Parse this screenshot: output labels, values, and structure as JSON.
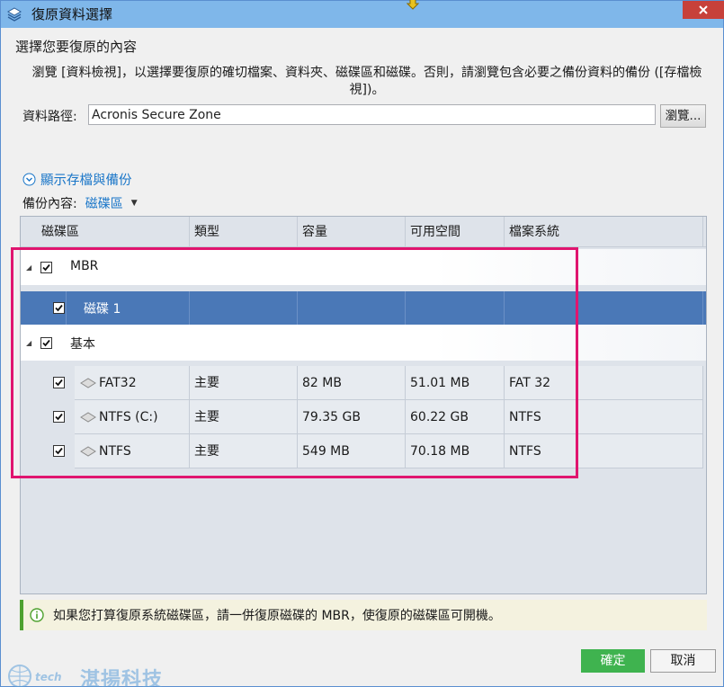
{
  "window": {
    "title": "復原資料選擇",
    "close_label": "✕"
  },
  "heading": "選擇您要復原的內容",
  "description": "瀏覽 [資料檢視]，以選擇要復原的確切檔案、資料夾、磁碟區和磁碟。否則，請瀏覽包含必要之備份資料的備份 ([存檔檢視])。",
  "path": {
    "label": "資料路徑:",
    "value": "Acronis Secure Zone",
    "browse_label": "瀏覽..."
  },
  "show_archives_label": "顯示存檔與備份",
  "backup_content": {
    "label": "備份內容:",
    "value": "磁碟區"
  },
  "grid": {
    "columns": [
      "磁碟區",
      "類型",
      "容量",
      "可用空間",
      "檔案系統"
    ],
    "groups": [
      {
        "label": "MBR",
        "items": [
          {
            "name": "磁碟 1",
            "type": "",
            "capacity": "",
            "free": "",
            "fs": "",
            "checked": true,
            "selected": true
          }
        ]
      },
      {
        "label": "基本",
        "items": [
          {
            "name": "FAT32",
            "type": "主要",
            "capacity": "82 MB",
            "free": "51.01 MB",
            "fs": "FAT 32",
            "checked": true
          },
          {
            "name": "NTFS (C:)",
            "type": "主要",
            "capacity": "79.35 GB",
            "free": "60.22 GB",
            "fs": "NTFS",
            "checked": true
          },
          {
            "name": "NTFS",
            "type": "主要",
            "capacity": "549 MB",
            "free": "70.18 MB",
            "fs": "NTFS",
            "checked": true
          }
        ]
      }
    ]
  },
  "info_message": "如果您打算復原系統磁碟區，請一併復原磁碟的 MBR，使復原的磁碟區可開機。",
  "buttons": {
    "ok": "確定",
    "cancel": "取消"
  },
  "watermark": {
    "small": "tech",
    "text": "湛揚科技"
  },
  "colors": {
    "titlebar": "#7fb7ea",
    "selection": "#4a78b7",
    "link": "#1a76c8",
    "ok_button": "#3fb34f",
    "highlight_border": "#e0156f",
    "info_accent": "#4ea12f"
  }
}
